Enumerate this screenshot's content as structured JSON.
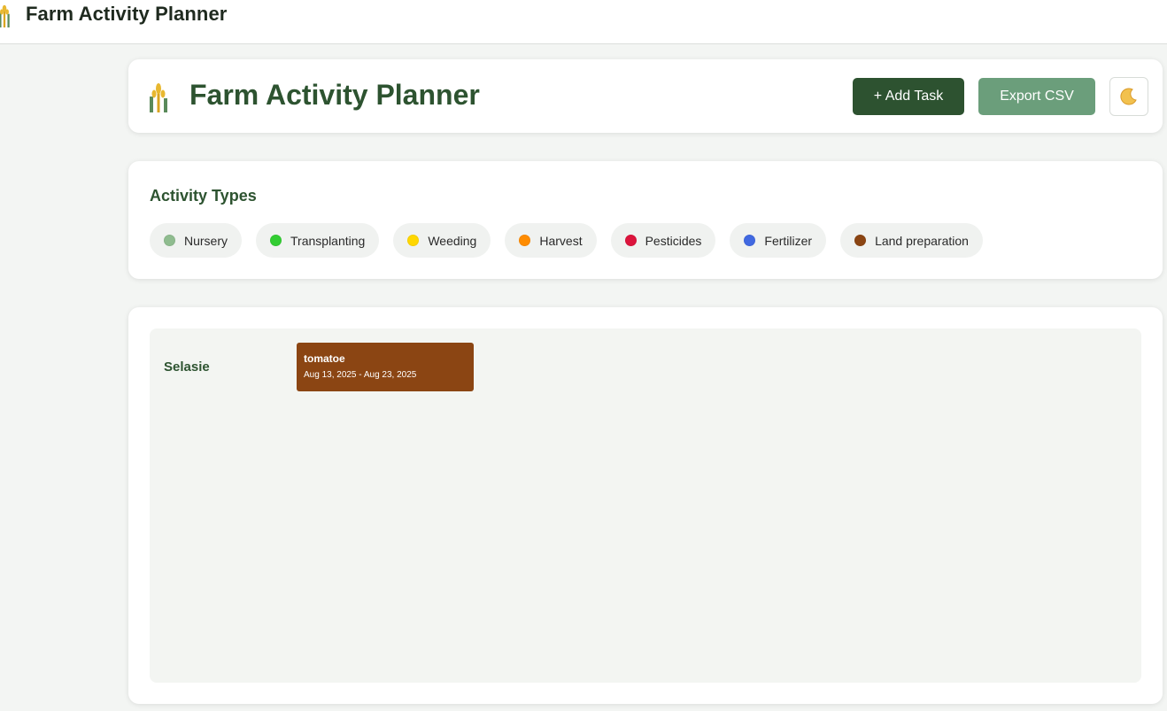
{
  "app": {
    "title": "Farm Activity Planner"
  },
  "header": {
    "title": "Farm Activity Planner",
    "add_task_label": "+ Add Task",
    "export_label": "Export CSV",
    "theme_icon": "moon-icon"
  },
  "activity_types": {
    "heading": "Activity Types",
    "items": [
      {
        "label": "Nursery",
        "color": "#8fbc8f"
      },
      {
        "label": "Transplanting",
        "color": "#32cd32"
      },
      {
        "label": "Weeding",
        "color": "#ffd700"
      },
      {
        "label": "Harvest",
        "color": "#ff8c00"
      },
      {
        "label": "Pesticides",
        "color": "#dc143c"
      },
      {
        "label": "Fertilizer",
        "color": "#4169e1"
      },
      {
        "label": "Land preparation",
        "color": "#8b4513"
      }
    ]
  },
  "timeline": {
    "rows": [
      {
        "label": "Selasie",
        "tasks": [
          {
            "name": "tomatoe",
            "dates": "Aug 13, 2025 - Aug 23, 2025",
            "color": "#8b4513"
          }
        ]
      }
    ]
  }
}
